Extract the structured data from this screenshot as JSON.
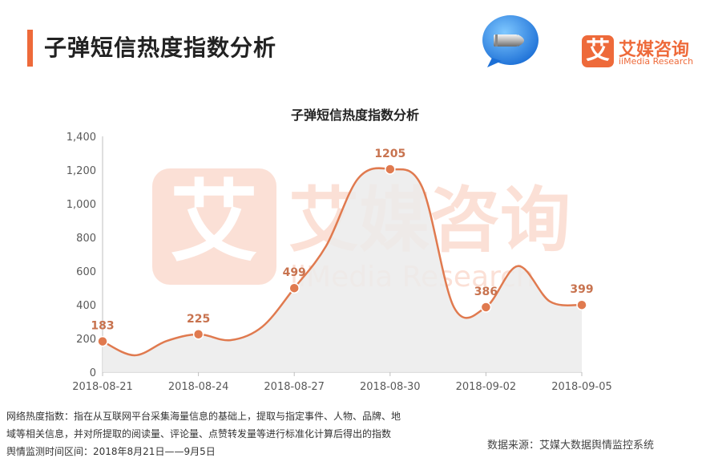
{
  "header": {
    "title": "子弹短信热度指数分析"
  },
  "brand": {
    "mark": "艾",
    "name_cn": "艾媒咨询",
    "name_en": "iiMedia Research"
  },
  "watermark": {
    "mark": "艾",
    "name_cn": "艾媒咨询",
    "name_en": "iiMedia Research"
  },
  "chart_data": {
    "type": "area",
    "title": "子弹短信热度指数分析",
    "xlabel": "",
    "ylabel": "",
    "ylim": [
      0,
      1400
    ],
    "yticks": [
      "0",
      "200",
      "400",
      "600",
      "800",
      "1,000",
      "1,200",
      "1,400"
    ],
    "xticks": [
      "2018-08-21",
      "2018-08-24",
      "2018-08-27",
      "2018-08-30",
      "2018-09-02",
      "2018-09-05"
    ],
    "x": [
      "2018-08-21",
      "2018-08-22",
      "2018-08-23",
      "2018-08-24",
      "2018-08-25",
      "2018-08-26",
      "2018-08-27",
      "2018-08-28",
      "2018-08-29",
      "2018-08-30",
      "2018-08-31",
      "2018-09-01",
      "2018-09-02",
      "2018-09-03",
      "2018-09-04",
      "2018-09-05"
    ],
    "values": [
      183,
      100,
      185,
      225,
      190,
      270,
      499,
      750,
      1150,
      1205,
      1100,
      385,
      386,
      630,
      420,
      399
    ],
    "labeled_points": [
      {
        "x": "2018-08-21",
        "label": "183"
      },
      {
        "x": "2018-08-24",
        "label": "225"
      },
      {
        "x": "2018-08-27",
        "label": "499"
      },
      {
        "x": "2018-08-30",
        "label": "1205"
      },
      {
        "x": "2018-09-02",
        "label": "386"
      },
      {
        "x": "2018-09-05",
        "label": "399"
      }
    ],
    "line_color": "#e07a4f",
    "fill_color": "#ebebeb",
    "grid": false,
    "legend": "none"
  },
  "notes": {
    "line1": "网络热度指数：指在从互联网平台采集海量信息的基础上，提取与指定事件、人物、品牌、地",
    "line2": "域等相关信息，并对所提取的阅读量、评论量、点赞转发量等进行标准化计算后得出的指数",
    "line3": "舆情监测时间区间：2018年8月21日——9月5日"
  },
  "source": "数据来源：艾媒大数据舆情监控系统"
}
